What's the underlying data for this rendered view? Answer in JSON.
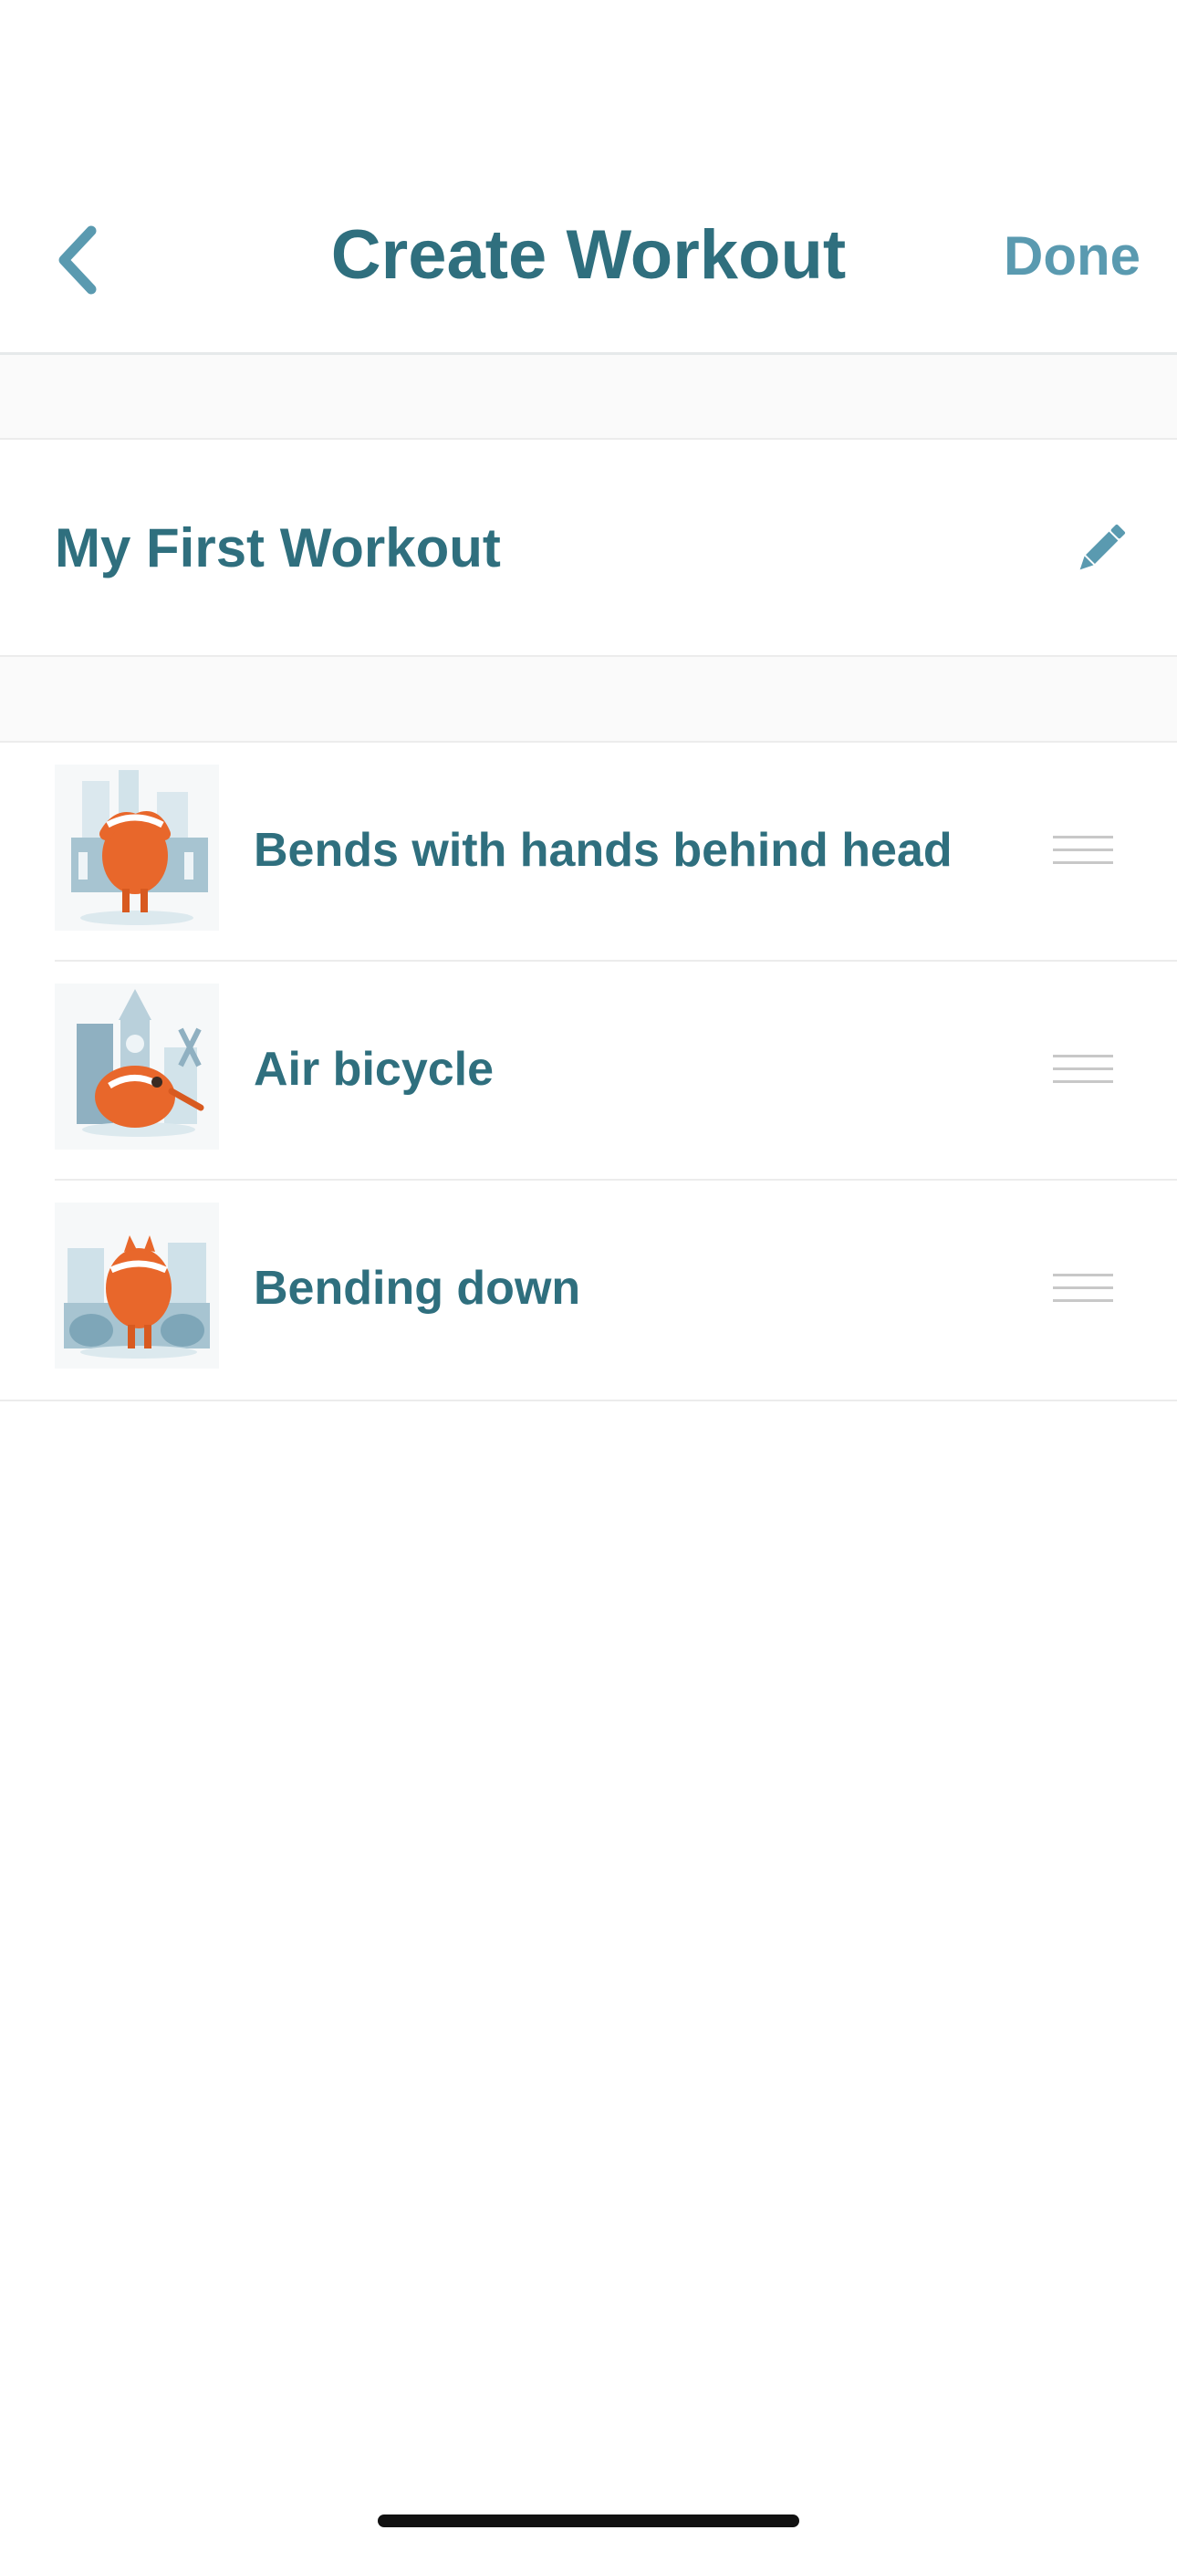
{
  "nav": {
    "title": "Create Workout",
    "done_label": "Done",
    "back_icon": "chevron-left-icon"
  },
  "workout": {
    "name": "My First Workout",
    "edit_icon": "pencil-icon"
  },
  "exercises": [
    {
      "label": "Bends with hands behind head",
      "thumbnail": "exercise-illustration"
    },
    {
      "label": "Air bicycle",
      "thumbnail": "exercise-illustration"
    },
    {
      "label": "Bending down",
      "thumbnail": "exercise-illustration"
    }
  ],
  "colors": {
    "title": "#2f6f7e",
    "accent": "#5a9ab0",
    "character": "#e8672b",
    "divider": "#ececec"
  }
}
